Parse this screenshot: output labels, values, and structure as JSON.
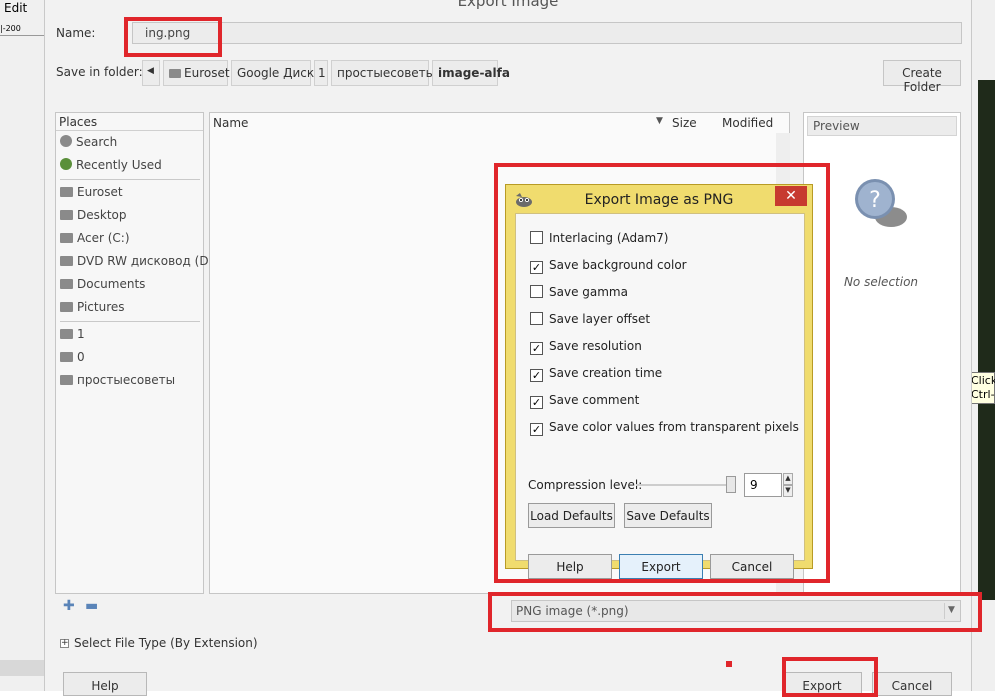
{
  "background": {
    "edit_menu": "Edit",
    "ruler_label": "|-200",
    "tooltip_lines": [
      "Click",
      "Ctrl-"
    ]
  },
  "main": {
    "title": "Export Image",
    "name_label": "Name:",
    "name_value": "ing.png",
    "save_in_label": "Save in folder:",
    "breadcrumbs": [
      "Euroset",
      "Google Диск",
      "1",
      "простыесоветы",
      "image-alfa"
    ],
    "create_folder": "Create Folder",
    "places": {
      "header": "Places",
      "items": [
        "Search",
        "Recently Used",
        "Euroset",
        "Desktop",
        "Acer (C:)",
        "DVD RW дисковод (D:)",
        "Documents",
        "Pictures",
        "1",
        "0",
        "простыесоветы"
      ]
    },
    "columns": {
      "name": "Name",
      "size": "Size",
      "modified": "Modified"
    },
    "preview": {
      "header": "Preview",
      "empty_text": "No selection"
    },
    "file_type_value": "PNG image (*.png)",
    "select_file_type": "Select File Type (By Extension)",
    "buttons": {
      "help": "Help",
      "export": "Export",
      "cancel": "Cancel"
    }
  },
  "png_dialog": {
    "title": "Export Image as PNG",
    "close_glyph": "✕",
    "options": [
      {
        "label": "Interlacing (Adam7)",
        "checked": false
      },
      {
        "label": "Save background color",
        "checked": true
      },
      {
        "label": "Save gamma",
        "checked": false
      },
      {
        "label": "Save layer offset",
        "checked": false
      },
      {
        "label": "Save resolution",
        "checked": true
      },
      {
        "label": "Save creation time",
        "checked": true
      },
      {
        "label": "Save comment",
        "checked": true
      },
      {
        "label": "Save color values from transparent pixels",
        "checked": true
      }
    ],
    "compression_label": "Compression level:",
    "compression_value": "9",
    "load_defaults": "Load Defaults",
    "save_defaults": "Save Defaults",
    "help": "Help",
    "export": "Export",
    "cancel": "Cancel"
  },
  "colors": {
    "highlight": "#e0262b",
    "dialog_frame": "#f0dc6e"
  }
}
